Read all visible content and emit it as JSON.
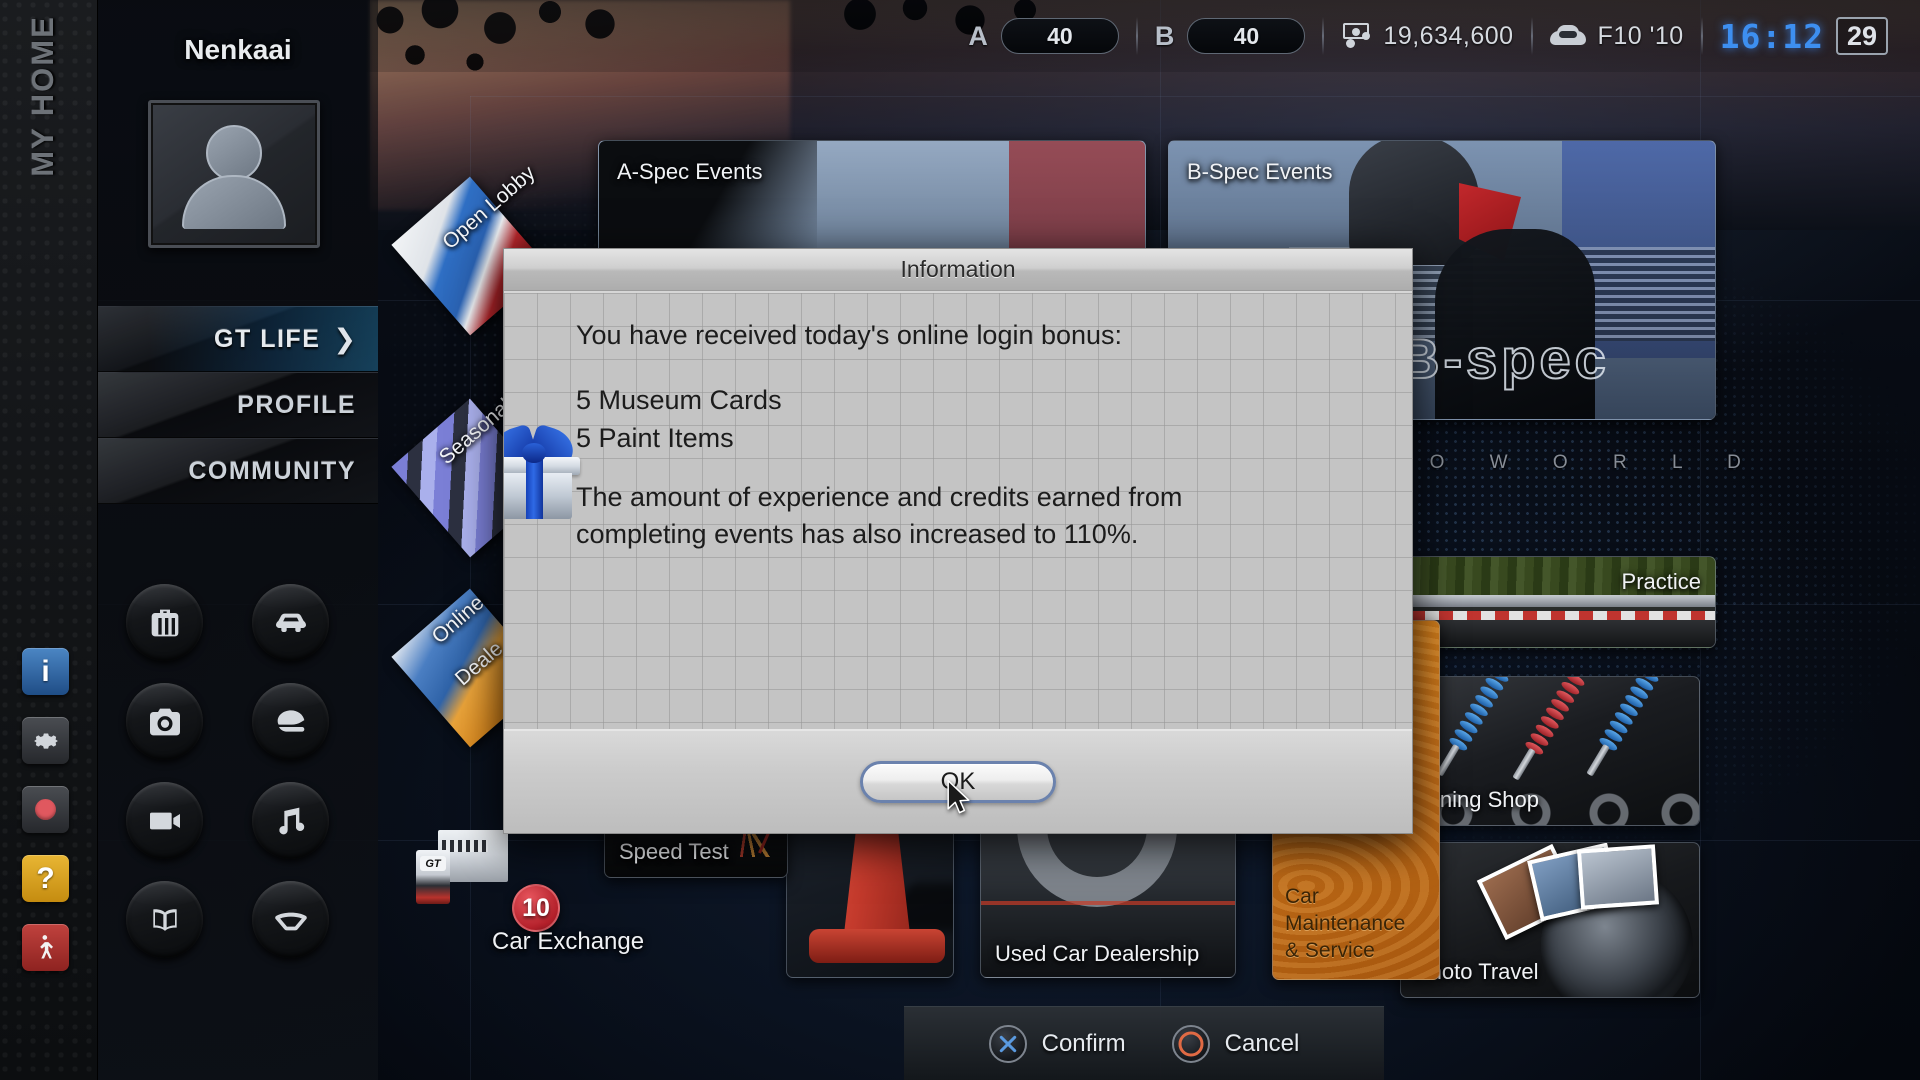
{
  "header": {
    "stats": [
      {
        "id": "a-spec-level",
        "letter": "A",
        "value": "40"
      },
      {
        "id": "b-spec-level",
        "letter": "B",
        "value": "40"
      }
    ],
    "credits": "19,634,600",
    "credits_icon": "credits-icon",
    "car": "F10 '10",
    "car_icon": "car-icon",
    "clock": "16:12",
    "day": "29"
  },
  "rail": {
    "title": "MY HOME",
    "icons": [
      {
        "name": "info-icon",
        "glyph": "i"
      },
      {
        "name": "gear-icon",
        "glyph": "⚙"
      },
      {
        "name": "record-icon",
        "glyph": ""
      },
      {
        "name": "help-icon",
        "glyph": "?"
      },
      {
        "name": "exit-icon",
        "glyph": "↴"
      }
    ]
  },
  "sidebar": {
    "username": "Nenkaai",
    "avatar_name": "user-avatar",
    "nav": [
      {
        "label": "GT LIFE",
        "active": true,
        "chevron": "❯"
      },
      {
        "label": "PROFILE",
        "active": false,
        "chevron": ""
      },
      {
        "label": "COMMUNITY",
        "active": false,
        "chevron": ""
      }
    ],
    "shortcuts": [
      {
        "name": "garage-icon",
        "title": "Garage"
      },
      {
        "name": "car-icon",
        "title": "Car"
      },
      {
        "name": "camera-icon",
        "title": "Photo Mode"
      },
      {
        "name": "helmet-icon",
        "title": "Driver"
      },
      {
        "name": "video-icon",
        "title": "Replay"
      },
      {
        "name": "music-icon",
        "title": "Music"
      },
      {
        "name": "book-icon",
        "title": "Manual"
      },
      {
        "name": "steering-wheel-icon",
        "title": "Controls"
      }
    ]
  },
  "content": {
    "tiles": [
      {
        "id": "a-spec-events",
        "label": "A-Spec Events"
      },
      {
        "id": "b-spec-events",
        "label": "B-Spec Events"
      },
      {
        "id": "practice",
        "label": "Practice"
      },
      {
        "id": "tuning-shop",
        "label": "Tuning Shop"
      },
      {
        "id": "photo-travel",
        "label": "Photo Travel"
      },
      {
        "id": "car-maintenance",
        "label": "Car\nMaintenance\n& Service"
      },
      {
        "id": "used-car-dealership",
        "label": "Used Car Dealership"
      },
      {
        "id": "speed-test",
        "label": "Speed Test"
      },
      {
        "id": "car-exchange",
        "label": "Car Exchange"
      },
      {
        "id": "open-lobby",
        "label": "Open Lobby"
      },
      {
        "id": "seasonal-events",
        "label": "Seasonal"
      },
      {
        "id": "online-dealership",
        "label": "Online"
      },
      {
        "id": "online-dealership-2",
        "label": "Deale"
      }
    ],
    "bspec_watermark": "B-spec",
    "gt_world": "I S M O   W O R L D",
    "car_exchange_badge": "10"
  },
  "bottom_bar": {
    "confirm": "Confirm",
    "cancel": "Cancel",
    "confirm_icon": "playstation-cross-icon",
    "cancel_icon": "playstation-circle-icon"
  },
  "dialog": {
    "title": "Information",
    "icon": "gift-box-icon",
    "lines": {
      "intro": "You have received today's online login bonus:",
      "reward1": "5 Museum Cards",
      "reward2": "5 Paint Items",
      "note_l1": "The amount of experience and credits earned from",
      "note_l2": "completing events has also increased to 110%."
    },
    "ok_label": "OK"
  },
  "colors": {
    "accent_blue": "#1a6e9e",
    "dialog_bg": "#c4c4c4",
    "focus_border": "#6b82ad",
    "clock_blue": "#3d8ff0",
    "orange_tile": "#e08a1e",
    "badge_red": "#b3202a"
  }
}
